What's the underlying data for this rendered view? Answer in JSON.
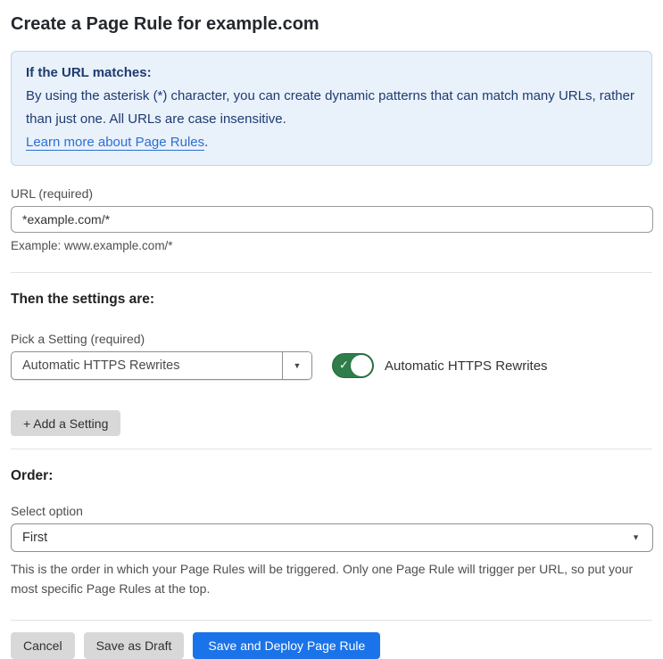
{
  "page": {
    "title": "Create a Page Rule for example.com"
  },
  "info_box": {
    "heading": "If the URL matches:",
    "body": "By using the asterisk (*) character, you can create dynamic patterns that can match many URLs, rather than just one. All URLs are case insensitive.",
    "link_label": "Learn more about Page Rules",
    "link_suffix": "."
  },
  "url_field": {
    "label": "URL (required)",
    "value": "*example.com/*",
    "helper": "Example: www.example.com/*"
  },
  "settings": {
    "heading": "Then the settings are:",
    "picker_label": "Pick a Setting (required)",
    "selected_setting": "Automatic HTTPS Rewrites",
    "toggle_state": "on",
    "toggle_label": "Automatic HTTPS Rewrites",
    "add_button_label": "+ Add a Setting"
  },
  "order": {
    "heading": "Order:",
    "select_label": "Select option",
    "selected_option": "First",
    "helper": "This is the order in which your Page Rules will be triggered. Only one Page Rule will trigger per URL, so put your most specific Page Rules at the top."
  },
  "footer": {
    "cancel_label": "Cancel",
    "save_draft_label": "Save as Draft",
    "save_deploy_label": "Save and Deploy Page Rule"
  },
  "icons": {
    "select_arrow": "▼",
    "toggle_check": "✓"
  },
  "colors": {
    "accent_blue": "#1a73e8",
    "info_bg": "#e9f1fb",
    "info_border": "#bcd6f1",
    "info_text": "#1e3b70",
    "link_blue": "#2d6fd4",
    "toggle_green": "#2e7d4a",
    "button_gray": "#d8d8d8"
  }
}
